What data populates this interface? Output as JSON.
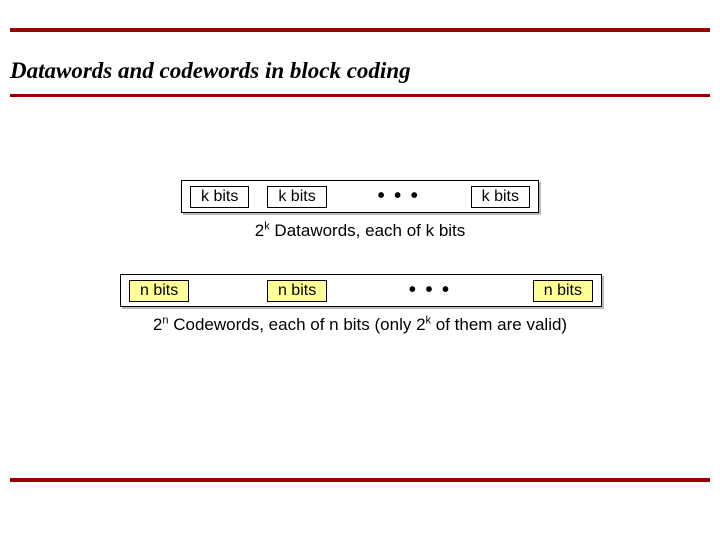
{
  "title": "Datawords and codewords in block coding",
  "datawords": {
    "cell_label": "k bits",
    "caption_prefix": "2",
    "caption_exp": "k",
    "caption_rest": " Datawords, each of k bits"
  },
  "codewords": {
    "cell_label": "n bits",
    "caption_prefix": "2",
    "caption_exp1": "n",
    "caption_mid": " Codewords, each of n bits (only 2",
    "caption_exp2": "k",
    "caption_end": " of them are valid)"
  },
  "ellipsis": "• • •"
}
